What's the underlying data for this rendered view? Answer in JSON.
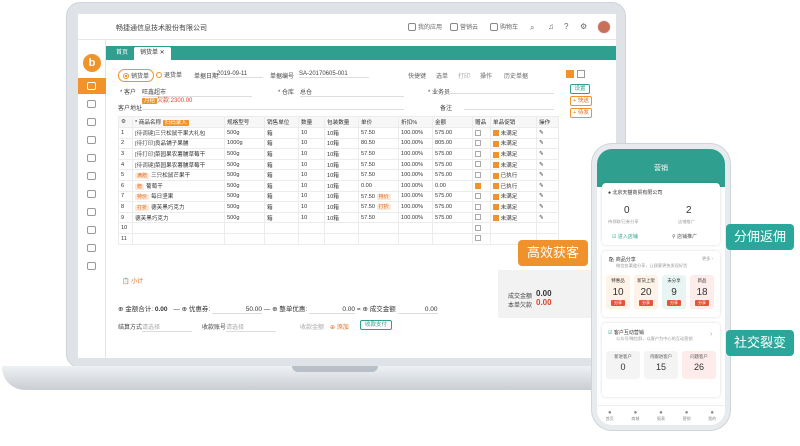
{
  "company": "畅捷通信息技术股份有限公司",
  "header_items": [
    "我的应用",
    "营销云",
    "购物车"
  ],
  "tabs": [
    "首页",
    "销货单"
  ],
  "order": {
    "type_options": [
      "销货单",
      "退货单"
    ],
    "date_label": "单据日期",
    "date": "2019-09-11",
    "no_label": "单据编号",
    "no": "SA-20170605-001",
    "tools": [
      "快捷键",
      "选单",
      "打印",
      "操作",
      "历史单据"
    ],
    "customer_label": "客户",
    "customer": "旺鑫超市",
    "customer_tag": "月结",
    "customer_debt": "欠款:2300.00",
    "warehouse_label": "仓库",
    "warehouse": "总仓",
    "clerk_label": "业务员",
    "address_label": "客户地址",
    "note_label": "备注",
    "btn_settings": "设置",
    "btn_add_ship": "+ 快送",
    "btn_add_order": "+ 待发"
  },
  "table": {
    "headers": [
      "",
      "商品名称",
      "扫码录入",
      "规格型号",
      "销售单位",
      "数量",
      "包装数量",
      "单价",
      "折扣%",
      "金额",
      "赠品",
      "单品促销",
      "操作"
    ],
    "rows": [
      {
        "n": "1",
        "tag": "[待调键]",
        "name": "三只松鼠干果大礼包",
        "spec": "500g",
        "unit": "箱",
        "qty": "10",
        "pack": "10箱",
        "price": "57.50",
        "disc": "100.00%",
        "amt": "575.00",
        "gift": false,
        "promo": "未满足",
        "ptag": ""
      },
      {
        "n": "2",
        "tag": "[待打印]",
        "name": "良品铺子果脯",
        "spec": "1000g",
        "unit": "箱",
        "qty": "10",
        "pack": "10箱",
        "price": "80.50",
        "disc": "100.00%",
        "amt": "805.00",
        "gift": false,
        "promo": "未满足",
        "ptag": ""
      },
      {
        "n": "3",
        "tag": "[待打印]",
        "name": "菜园果农薯脯草莓干",
        "spec": "500g",
        "unit": "箱",
        "qty": "10",
        "pack": "10箱",
        "price": "57.50",
        "disc": "100.00%",
        "amt": "575.00",
        "gift": false,
        "promo": "未满足",
        "ptag": ""
      },
      {
        "n": "4",
        "tag": "[待调键]",
        "name": "菜园果农薯脯草莓干",
        "spec": "500g",
        "unit": "箱",
        "qty": "10",
        "pack": "10箱",
        "price": "57.50",
        "disc": "100.00%",
        "amt": "575.00",
        "gift": false,
        "promo": "未满足",
        "ptag": ""
      },
      {
        "n": "5",
        "tag": "满赠",
        "name": "三只松鼠芒果干",
        "spec": "500g",
        "unit": "箱",
        "qty": "10",
        "pack": "10箱",
        "price": "57.50",
        "disc": "100.00%",
        "amt": "575.00",
        "gift": false,
        "promo": "已执行",
        "ptag": ""
      },
      {
        "n": "6",
        "tag": "赠",
        "name": "葡萄干",
        "spec": "500g",
        "unit": "箱",
        "qty": "10",
        "pack": "10箱",
        "price": "0.00",
        "disc": "100.00%",
        "amt": "0.00",
        "gift": true,
        "promo": "已执行",
        "ptag": ""
      },
      {
        "n": "7",
        "tag": "特价",
        "name": "每日坚果",
        "spec": "500g",
        "unit": "箱",
        "qty": "10",
        "pack": "10箱",
        "price": "57.50",
        "disc": "100.00%",
        "amt": "575.00",
        "gift": false,
        "promo": "未满足",
        "ptag": "特价"
      },
      {
        "n": "8",
        "tag": "打折",
        "name": "德芙黑巧克力",
        "spec": "500g",
        "unit": "箱",
        "qty": "10",
        "pack": "10箱",
        "price": "57.50",
        "disc": "100.00%",
        "amt": "575.00",
        "gift": false,
        "promo": "未满足",
        "ptag": "打折"
      },
      {
        "n": "9",
        "tag": "",
        "name": "德芙黑巧克力",
        "spec": "500g",
        "unit": "箱",
        "qty": "10",
        "pack": "10箱",
        "price": "57.50",
        "disc": "100.00%",
        "amt": "575.00",
        "gift": false,
        "promo": "未满足",
        "ptag": ""
      },
      {
        "n": "10",
        "tag": "",
        "name": "",
        "spec": "",
        "unit": "",
        "qty": "",
        "pack": "",
        "price": "",
        "disc": "",
        "amt": "",
        "gift": false,
        "promo": "",
        "ptag": ""
      },
      {
        "n": "11",
        "tag": "",
        "name": "",
        "spec": "",
        "unit": "",
        "qty": "",
        "pack": "",
        "price": "",
        "disc": "",
        "amt": "",
        "gift": false,
        "promo": "",
        "ptag": ""
      }
    ],
    "subtotal": "小计"
  },
  "footer": {
    "amount_label": "金额合计:",
    "amount": "0.00",
    "discount_label": "优惠券:",
    "discount": "50.00",
    "whole_label": "整单优惠:",
    "whole": "0.00",
    "final_label": "成交金额",
    "final": "0.00",
    "settle_label": "结算方式",
    "settle_ph": "请选择",
    "account_label": "收款账号",
    "account_ph": "请选择",
    "receive_label": "收款金额",
    "add": "添加",
    "pay_btn": "收款支付",
    "deal_label": "成交金额",
    "deal": "0.00",
    "debt_label": "本单欠款",
    "debt": "0.00"
  },
  "phone": {
    "title": "营销",
    "shop": "北京天猫商贸有限公司",
    "stat1_val": "0",
    "stat1_label": "待领取/已券分享",
    "stat2_val": "2",
    "stat2_label": "店铺推广",
    "entry1": "进入店铺",
    "entry2": "店铺推广",
    "share_title": "商品分享",
    "share_sub": "微信各渠道分享，让顾客更快发现好货",
    "share_more": "更多",
    "minis": [
      {
        "label": "特惠品",
        "val": "10",
        "btn": "分享"
      },
      {
        "label": "新货上架",
        "val": "20",
        "btn": "分享"
      },
      {
        "label": "未分享",
        "val": "9",
        "btn": "分享"
      },
      {
        "label": "新品",
        "val": "18",
        "btn": "分享"
      }
    ],
    "mkt_title": "客户互动营销",
    "mkt_sub": "公众号/微信群，以客户为中心的互动营销",
    "stats": [
      {
        "label": "新进客户",
        "val": "0"
      },
      {
        "label": "待跟进客户",
        "val": "15"
      },
      {
        "label": "问题客户",
        "val": "26"
      }
    ],
    "nav": [
      "首页",
      "商城",
      "报表",
      "营销",
      "我的"
    ]
  },
  "callouts": [
    "高效获客",
    "分佣返佣",
    "社交裂变"
  ],
  "colors": {
    "teal": "#2f9f8f",
    "orange": "#f0932b",
    "callout_orange": "#f0922c",
    "callout_teal": "#2aa79a"
  }
}
